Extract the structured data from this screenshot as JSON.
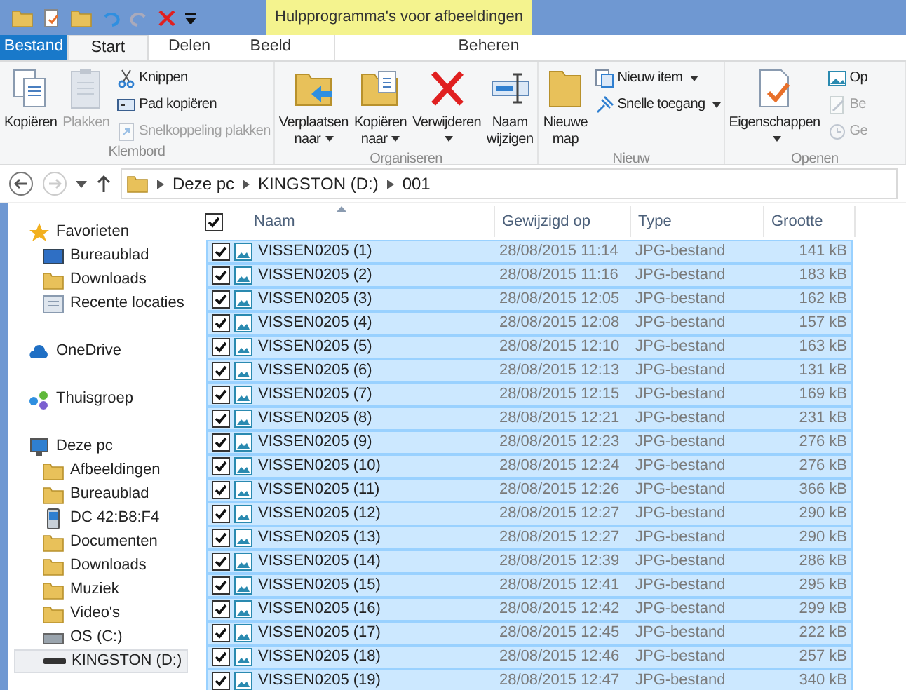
{
  "title_bar": {
    "context_label": "Hulpprogramma's voor afbeeldingen"
  },
  "tabs": [
    {
      "label": "Bestand",
      "kind": "file",
      "selected": false
    },
    {
      "label": "Start",
      "kind": "tab",
      "selected": true
    },
    {
      "label": "Delen",
      "kind": "tab",
      "selected": false
    },
    {
      "label": "Beeld",
      "kind": "tab",
      "selected": false
    },
    {
      "label": "Beheren",
      "kind": "context",
      "selected": false
    }
  ],
  "ribbon": {
    "groups": [
      {
        "label": "Klembord",
        "large": [
          {
            "label": "Kopiëren",
            "disabled": false,
            "dropdown": false
          },
          {
            "label": "Plakken",
            "disabled": true,
            "dropdown": false
          }
        ],
        "small": [
          {
            "label": "Knippen",
            "disabled": false,
            "dropdown": false
          },
          {
            "label": "Pad kopiëren",
            "disabled": false,
            "dropdown": false
          },
          {
            "label": "Snelkoppeling plakken",
            "disabled": true,
            "dropdown": false
          }
        ]
      },
      {
        "label": "Organiseren",
        "large": [
          {
            "label": "Verplaatsen naar",
            "disabled": false,
            "dropdown": true
          },
          {
            "label": "Kopiëren naar",
            "disabled": false,
            "dropdown": true
          },
          {
            "label": "Verwijderen",
            "disabled": false,
            "dropdown": true
          },
          {
            "label": "Naam wijzigen",
            "disabled": false,
            "dropdown": false
          }
        ]
      },
      {
        "label": "Nieuw",
        "large": [
          {
            "label": "Nieuwe map",
            "disabled": false,
            "dropdown": false
          }
        ],
        "small": [
          {
            "label": "Nieuw item",
            "disabled": false,
            "dropdown": true
          },
          {
            "label": "Snelle toegang",
            "disabled": false,
            "dropdown": true
          }
        ]
      },
      {
        "label": "Openen",
        "large": [
          {
            "label": "Eigenschappen",
            "disabled": false,
            "dropdown": true
          }
        ],
        "small": [
          {
            "label": "Op",
            "disabled": false
          },
          {
            "label": "Be",
            "disabled": true
          },
          {
            "label": "Ge",
            "disabled": true
          }
        ]
      }
    ]
  },
  "address_bar": {
    "forward_disabled": true,
    "crumbs": [
      "Deze pc",
      "KINGSTON (D:)",
      "001"
    ]
  },
  "sidebar": {
    "sections": [
      {
        "label": "Favorieten",
        "children": [
          {
            "label": "Bureaublad",
            "selected": false
          },
          {
            "label": "Downloads",
            "selected": false
          },
          {
            "label": "Recente locaties",
            "selected": false
          }
        ]
      },
      {
        "label": "OneDrive"
      },
      {
        "label": "Thuisgroep"
      },
      {
        "label": "Deze pc",
        "children": [
          {
            "label": "Afbeeldingen",
            "selected": false
          },
          {
            "label": "Bureaublad",
            "selected": false
          },
          {
            "label": "DC 42:B8:F4",
            "selected": false
          },
          {
            "label": "Documenten",
            "selected": false
          },
          {
            "label": "Downloads",
            "selected": false
          },
          {
            "label": "Muziek",
            "selected": false
          },
          {
            "label": "Video's",
            "selected": false
          },
          {
            "label": "OS (C:)",
            "selected": false
          },
          {
            "label": "KINGSTON (D:)",
            "selected": true
          }
        ]
      }
    ]
  },
  "file_list": {
    "select_all_checked": true,
    "columns": [
      "Naam",
      "Gewijzigd op",
      "Type",
      "Grootte"
    ],
    "rows": [
      {
        "name": "VISSEN0205 (1)",
        "modified": "28/08/2015 11:14",
        "type": "JPG-bestand",
        "size": "141 kB",
        "checked": true,
        "selected": true
      },
      {
        "name": "VISSEN0205 (2)",
        "modified": "28/08/2015 11:16",
        "type": "JPG-bestand",
        "size": "183 kB",
        "checked": true,
        "selected": true
      },
      {
        "name": "VISSEN0205 (3)",
        "modified": "28/08/2015 12:05",
        "type": "JPG-bestand",
        "size": "162 kB",
        "checked": true,
        "selected": true
      },
      {
        "name": "VISSEN0205 (4)",
        "modified": "28/08/2015 12:08",
        "type": "JPG-bestand",
        "size": "157 kB",
        "checked": true,
        "selected": true
      },
      {
        "name": "VISSEN0205 (5)",
        "modified": "28/08/2015 12:10",
        "type": "JPG-bestand",
        "size": "163 kB",
        "checked": true,
        "selected": true
      },
      {
        "name": "VISSEN0205 (6)",
        "modified": "28/08/2015 12:13",
        "type": "JPG-bestand",
        "size": "131 kB",
        "checked": true,
        "selected": true
      },
      {
        "name": "VISSEN0205 (7)",
        "modified": "28/08/2015 12:15",
        "type": "JPG-bestand",
        "size": "169 kB",
        "checked": true,
        "selected": true
      },
      {
        "name": "VISSEN0205 (8)",
        "modified": "28/08/2015 12:21",
        "type": "JPG-bestand",
        "size": "231 kB",
        "checked": true,
        "selected": true
      },
      {
        "name": "VISSEN0205 (9)",
        "modified": "28/08/2015 12:23",
        "type": "JPG-bestand",
        "size": "276 kB",
        "checked": true,
        "selected": true
      },
      {
        "name": "VISSEN0205 (10)",
        "modified": "28/08/2015 12:24",
        "type": "JPG-bestand",
        "size": "276 kB",
        "checked": true,
        "selected": true
      },
      {
        "name": "VISSEN0205 (11)",
        "modified": "28/08/2015 12:26",
        "type": "JPG-bestand",
        "size": "366 kB",
        "checked": true,
        "selected": true
      },
      {
        "name": "VISSEN0205 (12)",
        "modified": "28/08/2015 12:27",
        "type": "JPG-bestand",
        "size": "290 kB",
        "checked": true,
        "selected": true
      },
      {
        "name": "VISSEN0205 (13)",
        "modified": "28/08/2015 12:27",
        "type": "JPG-bestand",
        "size": "290 kB",
        "checked": true,
        "selected": true
      },
      {
        "name": "VISSEN0205 (14)",
        "modified": "28/08/2015 12:39",
        "type": "JPG-bestand",
        "size": "286 kB",
        "checked": true,
        "selected": true
      },
      {
        "name": "VISSEN0205 (15)",
        "modified": "28/08/2015 12:41",
        "type": "JPG-bestand",
        "size": "295 kB",
        "checked": true,
        "selected": true
      },
      {
        "name": "VISSEN0205 (16)",
        "modified": "28/08/2015 12:42",
        "type": "JPG-bestand",
        "size": "299 kB",
        "checked": true,
        "selected": true
      },
      {
        "name": "VISSEN0205 (17)",
        "modified": "28/08/2015 12:45",
        "type": "JPG-bestand",
        "size": "222 kB",
        "checked": true,
        "selected": true
      },
      {
        "name": "VISSEN0205 (18)",
        "modified": "28/08/2015 12:46",
        "type": "JPG-bestand",
        "size": "257 kB",
        "checked": true,
        "selected": true
      },
      {
        "name": "VISSEN0205 (19)",
        "modified": "28/08/2015 12:47",
        "type": "JPG-bestand",
        "size": "340 kB",
        "checked": true,
        "selected": true
      }
    ]
  }
}
